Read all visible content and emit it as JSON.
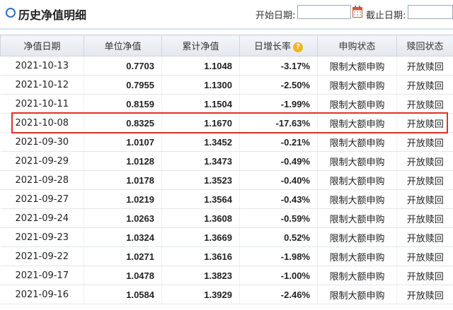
{
  "header": {
    "title": "历史净值明细",
    "start_label": "开始日期:",
    "end_label": "截止日期:",
    "start_value": "",
    "end_value": "",
    "icons": {
      "section": "circle-icon",
      "calendar": "calendar-icon"
    }
  },
  "table": {
    "columns": [
      "净值日期",
      "单位净值",
      "累计净值",
      "日增长率",
      "申购状态",
      "赎回状态"
    ],
    "help_icon": "?",
    "rows": [
      {
        "date": "2021-10-13",
        "unit": "0.7703",
        "acc": "1.1048",
        "growth": "-3.17%",
        "buy": "限制大额申购",
        "redeem": "开放赎回"
      },
      {
        "date": "2021-10-12",
        "unit": "0.7955",
        "acc": "1.1300",
        "growth": "-2.50%",
        "buy": "限制大额申购",
        "redeem": "开放赎回"
      },
      {
        "date": "2021-10-11",
        "unit": "0.8159",
        "acc": "1.1504",
        "growth": "-1.99%",
        "buy": "限制大额申购",
        "redeem": "开放赎回"
      },
      {
        "date": "2021-10-08",
        "unit": "0.8325",
        "acc": "1.1670",
        "growth": "-17.63%",
        "buy": "限制大额申购",
        "redeem": "开放赎回"
      },
      {
        "date": "2021-09-30",
        "unit": "1.0107",
        "acc": "1.3452",
        "growth": "-0.21%",
        "buy": "限制大额申购",
        "redeem": "开放赎回"
      },
      {
        "date": "2021-09-29",
        "unit": "1.0128",
        "acc": "1.3473",
        "growth": "-0.49%",
        "buy": "限制大额申购",
        "redeem": "开放赎回"
      },
      {
        "date": "2021-09-28",
        "unit": "1.0178",
        "acc": "1.3523",
        "growth": "-0.40%",
        "buy": "限制大额申购",
        "redeem": "开放赎回"
      },
      {
        "date": "2021-09-27",
        "unit": "1.0219",
        "acc": "1.3564",
        "growth": "-0.43%",
        "buy": "限制大额申购",
        "redeem": "开放赎回"
      },
      {
        "date": "2021-09-24",
        "unit": "1.0263",
        "acc": "1.3608",
        "growth": "-0.59%",
        "buy": "限制大额申购",
        "redeem": "开放赎回"
      },
      {
        "date": "2021-09-23",
        "unit": "1.0324",
        "acc": "1.3669",
        "growth": "0.52%",
        "buy": "限制大额申购",
        "redeem": "开放赎回"
      },
      {
        "date": "2021-09-22",
        "unit": "1.0271",
        "acc": "1.3616",
        "growth": "-1.98%",
        "buy": "限制大额申购",
        "redeem": "开放赎回"
      },
      {
        "date": "2021-09-17",
        "unit": "1.0478",
        "acc": "1.3823",
        "growth": "-1.00%",
        "buy": "限制大额申购",
        "redeem": "开放赎回"
      },
      {
        "date": "2021-09-16",
        "unit": "1.0584",
        "acc": "1.3929",
        "growth": "-2.46%",
        "buy": "限制大额申购",
        "redeem": "开放赎回"
      }
    ],
    "highlighted_row": "2021-10-08"
  },
  "colors": {
    "negative": "#1a8a1a",
    "positive": "#d11b1b",
    "highlight": "#e0302b",
    "accent": "#2f6fbf"
  }
}
